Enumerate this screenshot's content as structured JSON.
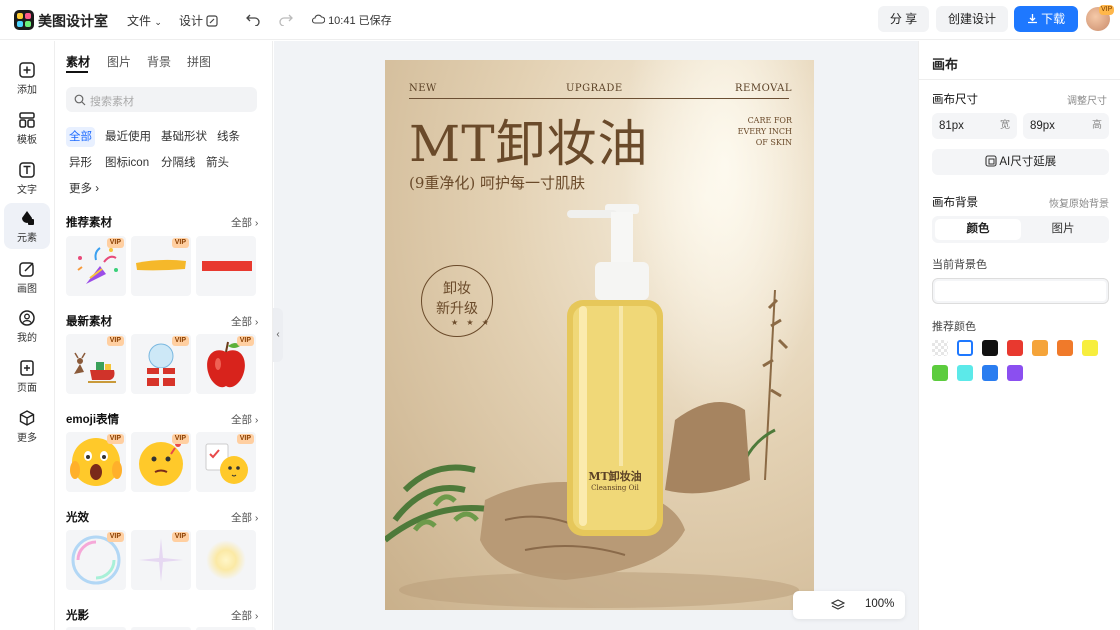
{
  "app": {
    "name": "美图设计室",
    "menu_file": "文件",
    "menu_design": "设计",
    "saved_status": "10:41 已保存"
  },
  "header": {
    "share_label": "分 享",
    "create_label": "创建设计",
    "download_label": "下载",
    "avatar_badge": "VIP"
  },
  "leftnav": {
    "items": [
      {
        "label": "添加",
        "icon": "plus-square-icon"
      },
      {
        "label": "模板",
        "icon": "template-icon"
      },
      {
        "label": "文字",
        "icon": "text-icon"
      },
      {
        "label": "元素",
        "icon": "shapes-icon"
      },
      {
        "label": "画图",
        "icon": "pen-edit-icon"
      },
      {
        "label": "我的",
        "icon": "user-icon"
      },
      {
        "label": "页面",
        "icon": "page-add-icon"
      },
      {
        "label": "更多",
        "icon": "cube-icon"
      }
    ]
  },
  "panel": {
    "tabs": [
      "素材",
      "图片",
      "背景",
      "拼图"
    ],
    "search_placeholder": "搜索素材",
    "chips": [
      "全部",
      "最近使用",
      "基础形状",
      "线条",
      "异形",
      "图标icon",
      "分隔线",
      "箭头",
      "更多"
    ],
    "sections": [
      {
        "title": "推荐素材",
        "all": "全部"
      },
      {
        "title": "最新素材",
        "all": "全部"
      },
      {
        "title": "emoji表情",
        "all": "全部"
      },
      {
        "title": "光效",
        "all": "全部"
      },
      {
        "title": "光影",
        "all": "全部"
      }
    ],
    "vip_tag": "VIP"
  },
  "poster": {
    "top_left": "NEW",
    "top_center": "UPGRADE",
    "top_right": "REMOVAL",
    "title": "MT卸妆油",
    "subtitle": "(9重净化) 呵护每一寸肌肤",
    "care_lines": [
      "CARE FOR",
      "EVERY INCH",
      "OF SKIN"
    ],
    "badge_line1": "卸妆",
    "badge_line2": "新升级",
    "stars": "★ ★ ★",
    "bottle_label": "MT卸妆油",
    "bottle_sub": "Cleansing Oil"
  },
  "zoom": {
    "value": "100%"
  },
  "right": {
    "title": "画布",
    "size_label": "画布尺寸",
    "adjust_label": "调整尺寸",
    "width_value": "81px",
    "width_unit": "宽",
    "height_value": "89px",
    "height_unit": "高",
    "ai_extend": "AI尺寸延展",
    "bg_label": "画布背景",
    "restore_label": "恢复原始背景",
    "seg_color": "颜色",
    "seg_image": "图片",
    "current_bg_label": "当前背景色",
    "recommend_label": "推荐颜色",
    "swatches": [
      "transparent",
      "#ffffff",
      "#111111",
      "#e8392f",
      "#f5a43a",
      "#f07a2a",
      "#f7ee3e",
      "#5ccc3e",
      "#5ce9e9",
      "#2a7df0",
      "#8b4ff0"
    ]
  }
}
